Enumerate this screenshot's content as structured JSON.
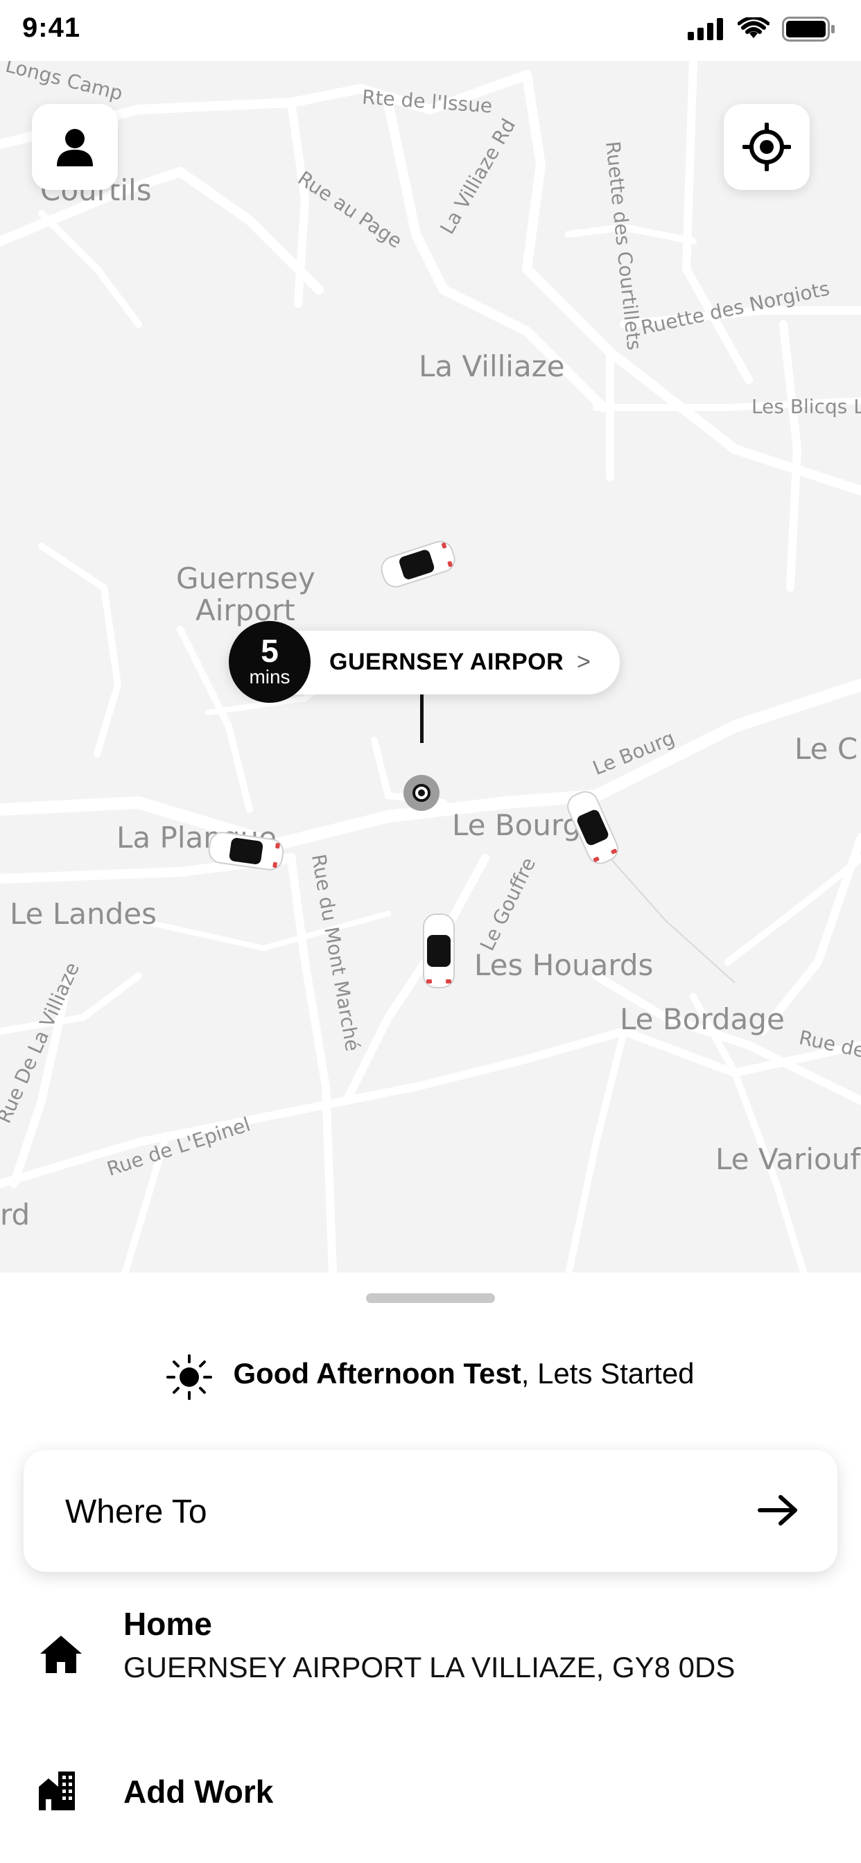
{
  "status_bar": {
    "time": "9:41",
    "icons": [
      "signal-icon",
      "wifi-icon",
      "battery-icon"
    ]
  },
  "map": {
    "labels": {
      "longs_camp": "Longs Camp",
      "las_courtils": "Las Courtils",
      "rte_de_lissue": "Rte de l'Issue",
      "rue_au_page": "Rue au Page",
      "la_villiaze_rd": "La Villiaze Rd",
      "ruette_des_courtillets": "Ruette des Courtillets",
      "ruette_des_norgiots": "Ruette des Norgiots",
      "la_villiaze": "La Villiaze",
      "les_blicqs": "Les Blicqs L",
      "guernsey_airport_line1": "Guernsey",
      "guernsey_airport_line2": "Airport",
      "le_bourg_road": "Le Bourg",
      "le_c": "Le C",
      "la_planque": "La Planque",
      "le_bourg": "Le Bourg",
      "le_landes": "Le Landes",
      "rue_du_mont_marche": "Rue du Mont Marché",
      "le_gouffre": "Le Gouffre",
      "les_houards": "Les Houards",
      "le_bordage": "Le Bordage",
      "rue_de": "Rue de",
      "rue_de_la_villiaze": "Rue De La Villiaze",
      "rue_de_lepinel": "Rue de L'Epinel",
      "le_variouf": "Le Variouf",
      "rd": "rd"
    },
    "buttons": {
      "profile_icon": "user-icon",
      "locate_icon": "crosshair-icon"
    },
    "pickup": {
      "eta_value": "5",
      "eta_unit": "mins",
      "location_name": "GUERNSEY AIRPOR",
      "chevron": ">"
    },
    "car_count": 4
  },
  "sheet": {
    "greeting_name": "Good Afternoon Test",
    "greeting_rest": ", Lets Started",
    "greeting_icon": "sun-icon",
    "search": {
      "label": "Where To",
      "arrow_icon": "arrow-right-icon"
    },
    "saved_places": [
      {
        "icon": "home-icon",
        "title": "Home",
        "subtitle": "GUERNSEY AIRPORT LA VILLIAZE, GY8 0DS"
      },
      {
        "icon": "building-icon",
        "title": "Add Work",
        "subtitle": ""
      }
    ]
  },
  "colors": {
    "map_background": "#f3f3f3",
    "road": "#ffffff",
    "map_text": "#8e8e8e",
    "accent": "#000000"
  }
}
